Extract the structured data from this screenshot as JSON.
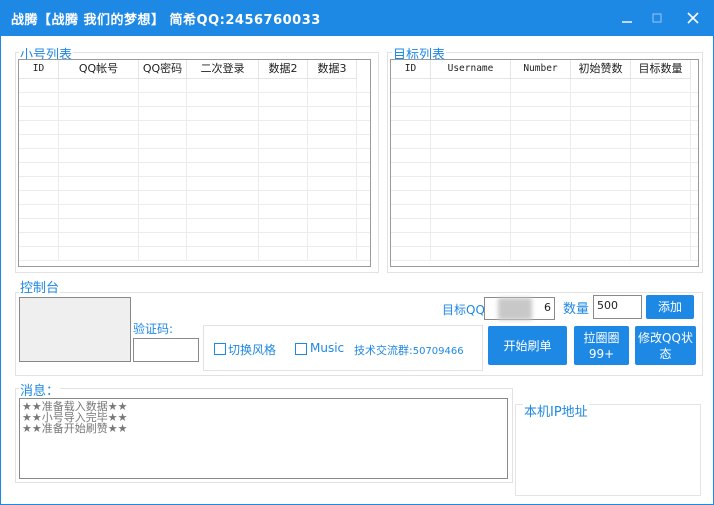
{
  "titlebar": {
    "title": "战腾【战腾 我们的梦想】  简希QQ:2456760033",
    "minimize_icon": "minimize-icon",
    "maximize_icon": "maximize-icon",
    "close_icon": "close-icon",
    "color": "#1e88e5"
  },
  "accounts_panel": {
    "label": "小号列表",
    "columns": [
      "ID",
      "QQ帐号",
      "QQ密码",
      "二次登录",
      "数据2",
      "数据3"
    ],
    "rows": []
  },
  "targets_panel": {
    "label": "目标列表",
    "columns": [
      "ID",
      "Username",
      "Number",
      "初始赞数",
      "目标数量"
    ],
    "rows": []
  },
  "console": {
    "label": "控制台",
    "captcha_label": "验证码:",
    "captcha_value": "",
    "target_qq_label": "目标QQ:",
    "target_qq_value": "6",
    "quantity_label": "数量",
    "quantity_value": "500",
    "add_button": "添加",
    "start_button": "开始刷单",
    "circle_button": "拉圈圈99+",
    "modify_status_button": "修改QQ状态",
    "switch_style_label": "切换风格",
    "music_label": "Music",
    "group_label": "技术交流群:",
    "group_number": "50709466"
  },
  "messages": {
    "label": "消息：",
    "lines": [
      "★★准备载入数据★★",
      "★★小号导入完毕★★",
      "★★准备开始刷赞★★"
    ]
  },
  "ip_panel": {
    "label": "本机IP地址"
  }
}
